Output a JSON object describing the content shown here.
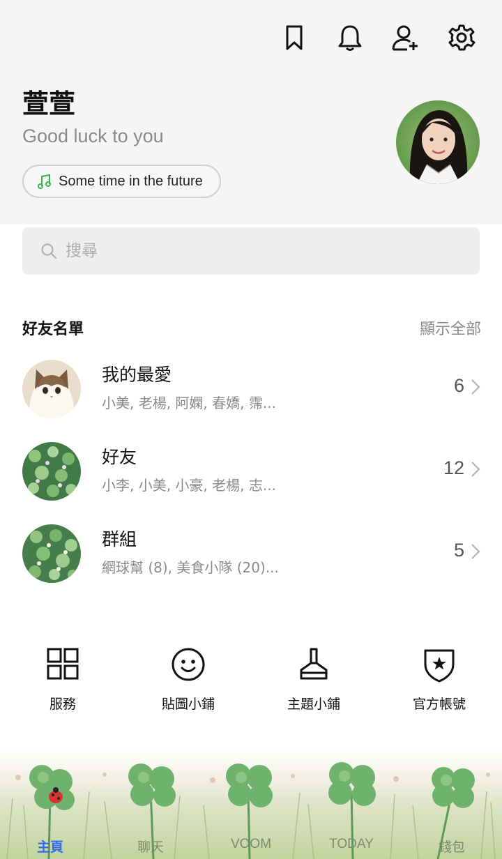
{
  "profile": {
    "name": "萱萱",
    "status": "Good luck to you",
    "music": "Some time in the future"
  },
  "top_icons": [
    "bookmark-icon",
    "bell-icon",
    "add-friend-icon",
    "gear-icon"
  ],
  "search": {
    "placeholder": "搜尋"
  },
  "friends": {
    "title": "好友名單",
    "show_all": "顯示全部",
    "rows": [
      {
        "title": "我的最愛",
        "sub": "小美, 老楊, 阿嫻, 春嬌, 霈...",
        "count": "6"
      },
      {
        "title": "好友",
        "sub": "小李, 小美, 小豪, 老楊, 志...",
        "count": "12"
      },
      {
        "title": "群組",
        "sub": "網球幫 (8), 美食小隊 (20)...",
        "count": "5"
      }
    ]
  },
  "services": [
    {
      "label": "服務",
      "icon": "grid-icon"
    },
    {
      "label": "貼圖小鋪",
      "icon": "smiley-icon"
    },
    {
      "label": "主題小鋪",
      "icon": "brush-icon"
    },
    {
      "label": "官方帳號",
      "icon": "shield-star-icon"
    }
  ],
  "tabs": [
    {
      "label": "主頁",
      "active": true
    },
    {
      "label": "聊天"
    },
    {
      "label": "VOOM"
    },
    {
      "label": "TODAY"
    },
    {
      "label": "錢包"
    }
  ],
  "colors": {
    "active_tab": "#2b6cf0",
    "music_note": "#3bb54a"
  }
}
